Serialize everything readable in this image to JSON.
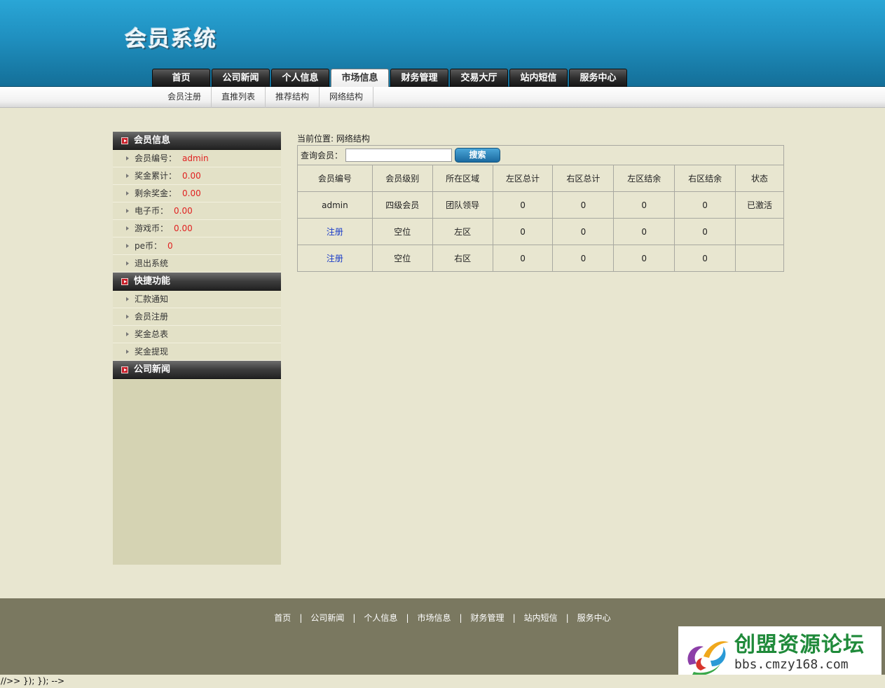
{
  "header": {
    "logo": "会员系统",
    "nav": [
      "首页",
      "公司新闻",
      "个人信息",
      "市场信息",
      "财务管理",
      "交易大厅",
      "站内短信",
      "服务中心"
    ],
    "active_index": 3
  },
  "subnav": [
    "会员注册",
    "直推列表",
    "推荐结构",
    "网络结构"
  ],
  "sidebar": {
    "member_info": {
      "title": "会员信息",
      "items": [
        {
          "label": "会员编号：",
          "value": "admin"
        },
        {
          "label": "奖金累计：",
          "value": "0.00"
        },
        {
          "label": "剩余奖金：",
          "value": "0.00"
        },
        {
          "label": "电子币：",
          "value": "0.00"
        },
        {
          "label": "游戏币：",
          "value": "0.00"
        },
        {
          "label": "pe币：",
          "value": "0"
        }
      ],
      "logout": "退出系统"
    },
    "quick": {
      "title": "快捷功能",
      "items": [
        "汇款通知",
        "会员注册",
        "奖金总表",
        "奖金提现"
      ]
    },
    "news": {
      "title": "公司新闻"
    }
  },
  "content": {
    "breadcrumb": "当前位置: 网络结构",
    "search_label": "查询会员：",
    "search_value": "",
    "search_button": "搜索",
    "table": {
      "headers": [
        "会员编号",
        "会员级别",
        "所在区域",
        "左区总计",
        "右区总计",
        "左区结余",
        "右区结余",
        "状态"
      ],
      "rows": [
        [
          "admin",
          "四级会员",
          "团队领导",
          "0",
          "0",
          "0",
          "0",
          "已激活"
        ],
        [
          "注册",
          "空位",
          "左区",
          "0",
          "0",
          "0",
          "0",
          ""
        ],
        [
          "注册",
          "空位",
          "右区",
          "0",
          "0",
          "0",
          "0",
          ""
        ]
      ]
    }
  },
  "footer": {
    "links": [
      "首页",
      "公司新闻",
      "个人信息",
      "市场信息",
      "财务管理",
      "站内短信",
      "服务中心"
    ],
    "separator": "|"
  },
  "watermark": {
    "title": "创盟资源论坛",
    "url": "bbs.cmzy168.com"
  },
  "bottom_code": "//>> }); }); -->"
}
